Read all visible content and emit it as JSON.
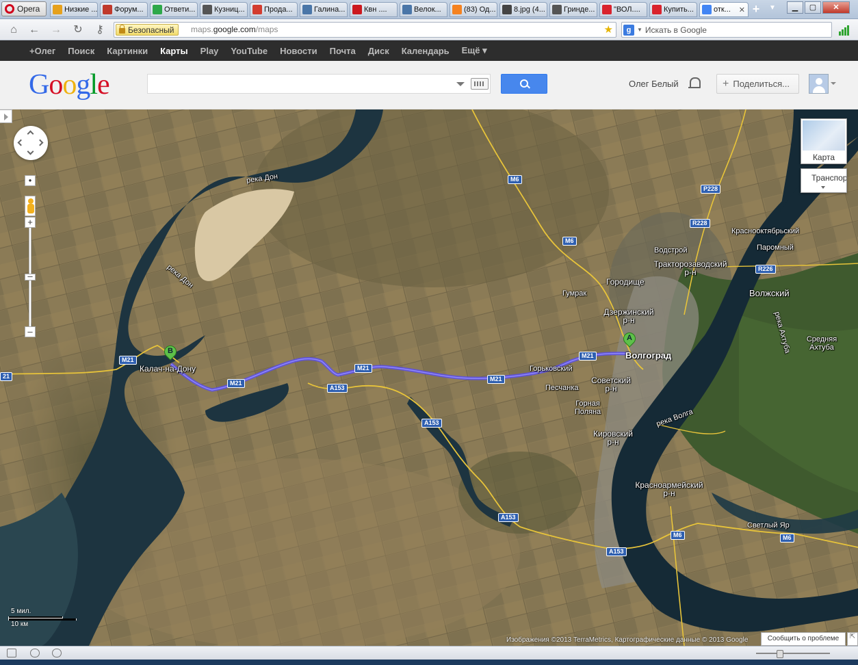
{
  "browser": {
    "menu_label": "Opera",
    "tabs": [
      {
        "label": "Низкие ...",
        "color": "#e6a11d"
      },
      {
        "label": "Форум...",
        "color": "#c0392b"
      },
      {
        "label": "Ответи...",
        "color": "#2ea84a"
      },
      {
        "label": "Кузниц...",
        "color": "#555555"
      },
      {
        "label": "Прода...",
        "color": "#d33c2f"
      },
      {
        "label": "Галина...",
        "color": "#4a76a8"
      },
      {
        "label": "Квн ....",
        "color": "#cc181e"
      },
      {
        "label": "Велок...",
        "color": "#4a76a8"
      },
      {
        "label": "(83) Од...",
        "color": "#f58220"
      },
      {
        "label": "8.jpg (4...",
        "color": "#444444"
      },
      {
        "label": "Гринде...",
        "color": "#555555"
      },
      {
        "label": "\"ВОЛ....",
        "color": "#d9232d"
      },
      {
        "label": "Купить...",
        "color": "#d9232d"
      },
      {
        "label": "отк...",
        "color": "#4285f4"
      }
    ],
    "secure_label": "Безопасный",
    "url_prefix": "maps.",
    "url_domain": "google.com",
    "url_path": "/maps",
    "search_placeholder": "Искать в Google"
  },
  "google_bar": {
    "items": [
      "+Олег",
      "Поиск",
      "Картинки",
      "Карты",
      "Play",
      "YouTube",
      "Новости",
      "Почта",
      "Диск",
      "Календарь",
      "Ещё ▾"
    ],
    "selected": "Карты"
  },
  "header": {
    "logo_letters": [
      {
        "ch": "G",
        "color": "#3369e8"
      },
      {
        "ch": "o",
        "color": "#d50f25"
      },
      {
        "ch": "o",
        "color": "#eeb211"
      },
      {
        "ch": "g",
        "color": "#3369e8"
      },
      {
        "ch": "l",
        "color": "#009925"
      },
      {
        "ch": "e",
        "color": "#d50f25"
      }
    ],
    "search_value": "",
    "user_name": "Олег Белый",
    "share_label": "Поделиться..."
  },
  "map": {
    "map_type_label": "Карта",
    "layers_label": "Транспорт",
    "scale_miles": "5 мил.",
    "scale_km": "10 км",
    "attribution": "Изображения ©2013 TerraMetrics, Картографические данные © 2013 Google",
    "report_label": "Сообщить о проблеме",
    "marker_a": "A",
    "marker_b": "B",
    "labels": {
      "reka_don_1": "река Дон",
      "reka_don_2": "река Дон",
      "kalach": "Калач-на-Дону",
      "volgograd": "Волгоград",
      "gorkovsky": "Горьковский",
      "peschanka": "Песчанка",
      "sovetsky": "Советский\nр-н",
      "gornaya": "Горная\nПоляна",
      "kirovsky": "Кировский\nр-н",
      "krasnoarmeysky": "Красноармейский\nр-н",
      "dzerzhinsky": "Дзержинский\nр-н",
      "gumrak": "Гумрак",
      "gorodishche": "Городище",
      "vodstroy": "Водстрой",
      "traktorozavodsky": "Тракторозаводский\nр-н",
      "krasnooktyabrsky": "Краснооктябрьский",
      "paromny": "Паромный",
      "volzhsky": "Волжский",
      "akhtuba": "река Ахтуба",
      "srednyaya": "Средняя\nАхтуба",
      "volga": "река Волга",
      "svetly": "Светлый Яр"
    },
    "shields": {
      "m6_1": "M6",
      "m6_2": "M6",
      "m6_3": "M6",
      "m6_4": "M6",
      "r228_1": "P228",
      "r228_2": "R228",
      "r226": "R226",
      "m21_1": "M21",
      "m21_2": "M21",
      "m21_3": "M21",
      "m21_4": "M21",
      "m21_5": "M21",
      "m21_6": "21",
      "a153_1": "A153",
      "a153_2": "A153",
      "a153_3": "A153",
      "a153_4": "A153"
    }
  }
}
